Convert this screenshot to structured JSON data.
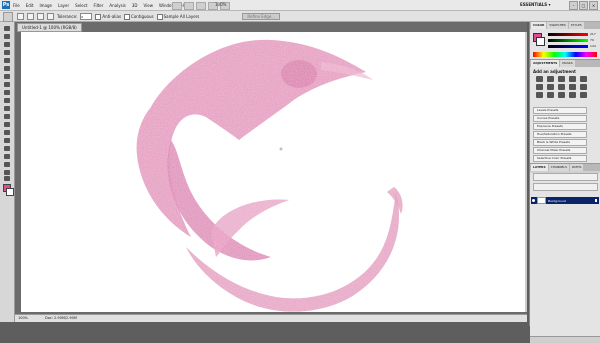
{
  "menubar": {
    "logo": "Ps",
    "items": [
      "File",
      "Edit",
      "Image",
      "Layer",
      "Select",
      "Filter",
      "Analysis",
      "3D",
      "View",
      "Window",
      "Help"
    ],
    "zoom": "100%",
    "workspace": "ESSENTIALS ▾",
    "window_buttons": [
      "–",
      "□",
      "×"
    ]
  },
  "options": {
    "tolerance_label": "Tolerance:",
    "tolerance_value": "0",
    "antialias": "Anti-alias",
    "contiguous": "Contiguous",
    "sample_all": "Sample All Layers",
    "refine": "Refine Edge..."
  },
  "document": {
    "tab": "Untitled-1 @ 100% (RGB/8)",
    "zoom_status": "100%",
    "doc_status": "Doc: 2.90M/2.90M"
  },
  "colors": {
    "foreground": "#d94f90",
    "background": "#ffffff",
    "accent": "#0a246a"
  },
  "panels": {
    "color_tabs": [
      "COLOR",
      "SWATCHES",
      "STYLES"
    ],
    "rgb": {
      "r": "R",
      "g": "G",
      "b": "B",
      "r_val": "217",
      "g_val": "79",
      "b_val": "144"
    },
    "adj_tabs": [
      "ADJUSTMENTS",
      "MASKS"
    ],
    "adj_title": "Add an adjustment",
    "presets": [
      "Levels Presets",
      "Curves Presets",
      "Exposure Presets",
      "Hue/Saturation Presets",
      "Black & White Presets",
      "Channel Mixer Presets",
      "Selective Color Presets"
    ],
    "layer_tabs": [
      "LAYERS",
      "CHANNELS",
      "PATHS"
    ],
    "layer_name": "Background"
  }
}
